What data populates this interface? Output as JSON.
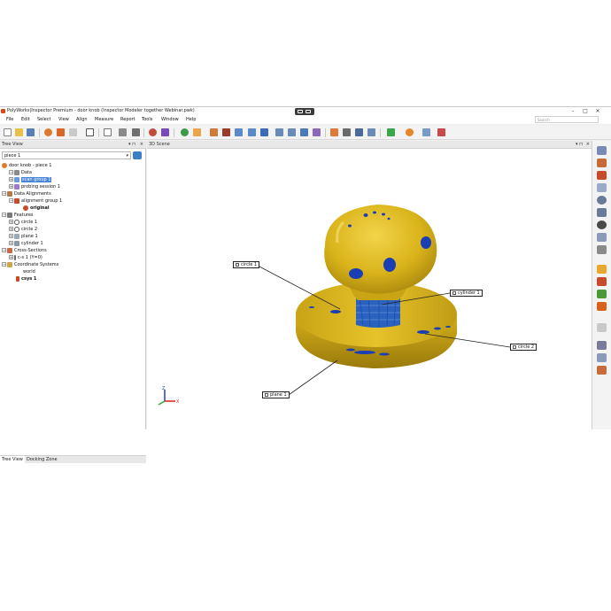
{
  "window": {
    "title": "PolyWorks|Inspector Premium - door knob (Inspector Modeler together Webinar.pwk)",
    "search_placeholder": "Search"
  },
  "menu": [
    "File",
    "Edit",
    "Select",
    "View",
    "Align",
    "Measure",
    "Report",
    "Tools",
    "Window",
    "Help"
  ],
  "tree_view": {
    "title": "Tree View",
    "piece_select": "piece 1",
    "nodes": [
      {
        "label": "door knob - piece 1",
        "icon": "object-icon"
      },
      {
        "label": "Data",
        "icon": "folder-icon"
      },
      {
        "label": "scan group 1",
        "icon": "scan-group-icon",
        "selected": true
      },
      {
        "label": "probing session 1",
        "icon": "probe-icon"
      },
      {
        "label": "Data Alignments",
        "icon": "alignment-icon"
      },
      {
        "label": "alignment group 1",
        "icon": "alignment-group-icon"
      },
      {
        "label": "original",
        "icon": "original-icon"
      },
      {
        "label": "Features",
        "icon": "features-icon"
      },
      {
        "label": "circle 1",
        "icon": "circle-icon"
      },
      {
        "label": "circle 2",
        "icon": "circle-icon"
      },
      {
        "label": "plane 1",
        "icon": "plane-icon"
      },
      {
        "label": "cylinder 1",
        "icon": "cylinder-icon"
      },
      {
        "label": "Cross-Sections",
        "icon": "cross-section-icon"
      },
      {
        "label": "c-s 1 (Y=0)",
        "icon": "section-icon"
      },
      {
        "label": "Coordinate Systems",
        "icon": "coordinate-systems-icon"
      },
      {
        "label": "world",
        "icon": ""
      },
      {
        "label": "csys 1",
        "icon": "csys-icon"
      }
    ],
    "tabs": [
      "Tree View",
      "Docking Zone"
    ]
  },
  "scene": {
    "title": "3D Scene",
    "callouts": [
      "circle 1",
      "cylinder 1",
      "circle 2",
      "plane 1"
    ],
    "axis_labels": {
      "z": "Z",
      "x": "X"
    }
  },
  "colors": {
    "model_yellow": "#d9b31a",
    "deviation_blue": "#1a3fb5",
    "selection": "#4a86d8"
  }
}
